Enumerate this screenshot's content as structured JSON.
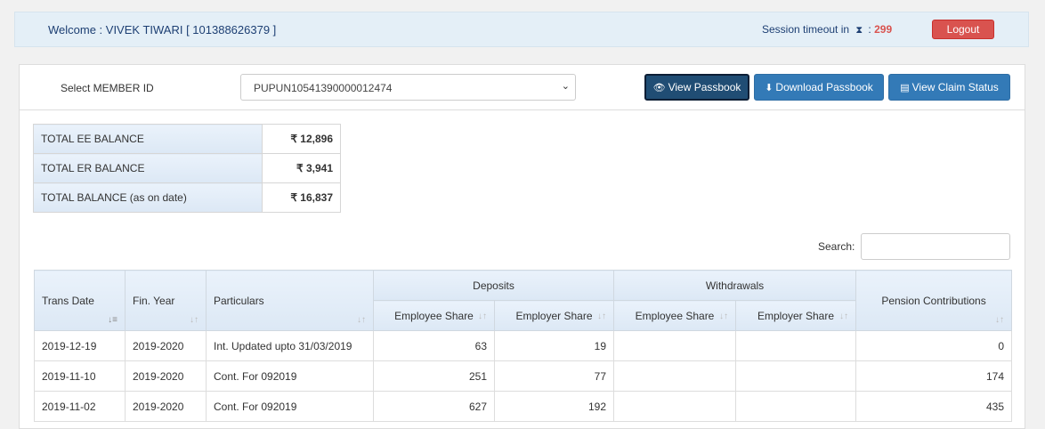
{
  "header": {
    "welcome": "Welcome : VIVEK TIWARI [ 101388626379 ]",
    "session_label": "Session timeout in",
    "session_sep": ":",
    "session_count": "299",
    "logout_label": "Logout"
  },
  "toolbar": {
    "member_label": "Select MEMBER ID",
    "member_value": "PUPUN10541390000012474",
    "view_passbook": "View Passbook",
    "download_passbook": "Download Passbook",
    "view_claim_status": "View Claim Status"
  },
  "balances": [
    {
      "label": "TOTAL EE BALANCE",
      "value": "₹ 12,896"
    },
    {
      "label": "TOTAL ER BALANCE",
      "value": "₹ 3,941"
    },
    {
      "label": "TOTAL BALANCE (as on date)",
      "value": "₹ 16,837"
    }
  ],
  "search": {
    "label": "Search:",
    "value": ""
  },
  "table": {
    "headers": {
      "trans_date": "Trans Date",
      "fin_year": "Fin. Year",
      "particulars": "Particulars",
      "deposits": "Deposits",
      "withdrawals": "Withdrawals",
      "pension": "Pension Contributions",
      "employee_share": "Employee Share",
      "employer_share": "Employer Share"
    },
    "rows": [
      {
        "date": "2019-12-19",
        "fy": "2019-2020",
        "particulars": "Int. Updated upto 31/03/2019",
        "dep_ee": "63",
        "dep_er": "19",
        "wd_ee": "",
        "wd_er": "",
        "pension": "0"
      },
      {
        "date": "2019-11-10",
        "fy": "2019-2020",
        "particulars": "Cont. For 092019",
        "dep_ee": "251",
        "dep_er": "77",
        "wd_ee": "",
        "wd_er": "",
        "pension": "174"
      },
      {
        "date": "2019-11-02",
        "fy": "2019-2020",
        "particulars": "Cont. For 092019",
        "dep_ee": "627",
        "dep_er": "192",
        "wd_ee": "",
        "wd_er": "",
        "pension": "435"
      }
    ]
  }
}
